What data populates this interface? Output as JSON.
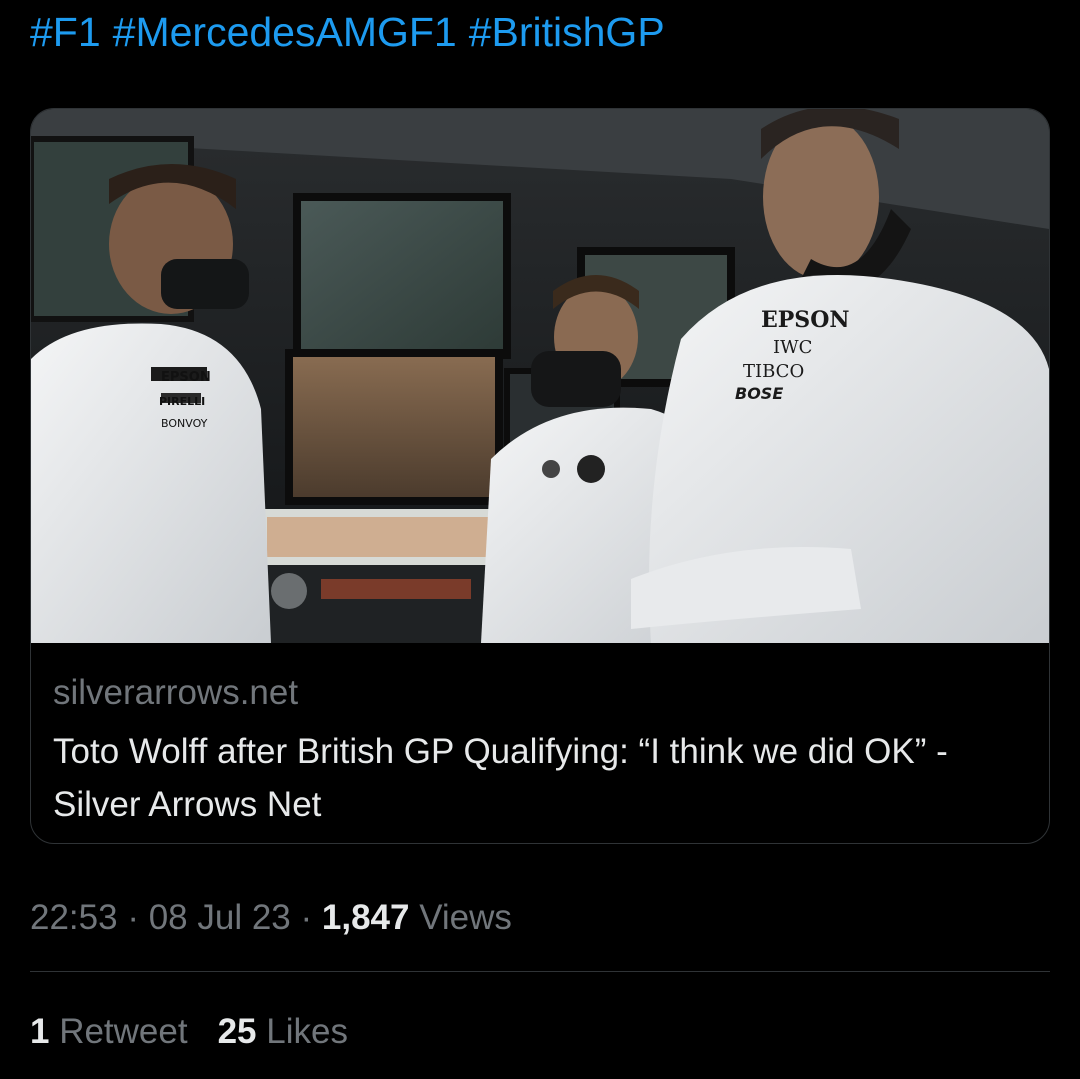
{
  "tweet": {
    "hashtags": [
      "#F1",
      "#MercedesAMGF1",
      "#BritishGP"
    ]
  },
  "link_card": {
    "image_alt": "Mercedes team members on the pit wall",
    "domain": "silverarrows.net",
    "title": "Toto Wolff after British GP Qualifying: “I think we did OK” - Silver Arrows Net",
    "image_text": {
      "sponsor_left": "EPSON",
      "sponsor_right_1": "EPSON",
      "sponsor_right_2": "IWC",
      "sponsor_right_3": "TIBCO",
      "sponsor_right_4": "BOSE",
      "sponsor_left_2": "PIRELLI",
      "sponsor_left_3": "BONVOY"
    }
  },
  "meta": {
    "time": "22:53",
    "sep1": " · ",
    "date": "08 Jul 23",
    "sep2": " · ",
    "views_count": "1,847",
    "views_label": " Views"
  },
  "stats": {
    "retweets_count": "1",
    "retweets_label": " Retweet",
    "likes_count": "25",
    "likes_label": " Likes"
  },
  "colors": {
    "background": "#000000",
    "link": "#1d9bf0",
    "primary_text": "#e7e9ea",
    "secondary_text": "#71767b",
    "border": "#2f3336"
  }
}
